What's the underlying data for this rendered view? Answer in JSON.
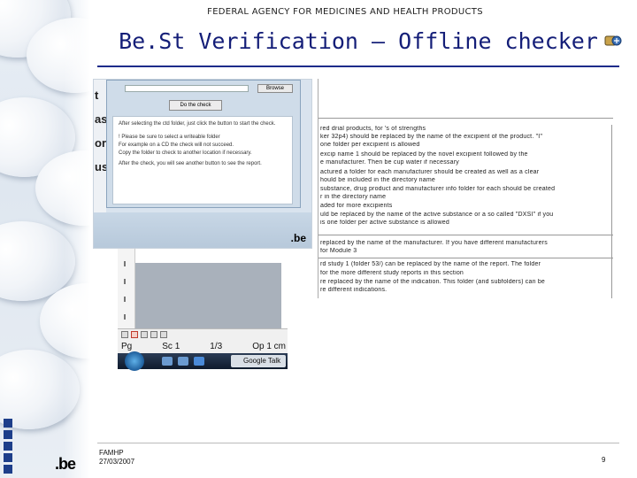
{
  "header": {
    "agency": "FEDERAL AGENCY FOR MEDICINES AND HEALTH PRODUCTS",
    "title": "Be.St Verification – Offline checker"
  },
  "screenshot": {
    "gutter_letters": [
      "t",
      "as",
      "ort",
      "us"
    ],
    "dialog": {
      "browse_label": "Browse",
      "do_check_label": "Do the check",
      "instructions": [
        "After selecting the ctd folder, just click the button to start the check.",
        "! Please be sure to select a writeable folder",
        "For example on a CD the check will not succeed.",
        "Copy the folder to check to another location if necessary.",
        "After the check, you will see another button to see the report."
      ]
    },
    "badge": ".be",
    "status": {
      "page": "Pg",
      "section": "Sc 1",
      "page_of": "1/3",
      "position": "Op 1 cm"
    },
    "taskbar": {
      "app_label": "Google Talk"
    }
  },
  "document": {
    "lines": [
      "red drial products, for 's of strengths",
      "ker 32p4) should be replaced by the name of the excipient of the product. \"I\"",
      "one folder per excipient is allowed",
      "excip name 1 should be replaced by the novel excipient followed by the",
      "e manufacturer. Then be cup water if necessary",
      "actured a folder for each manufacturer should be created as well as a clear",
      "hould be included in the directory name",
      "substance, drug product and manufacturer info folder for each should be created",
      "r in the directory name",
      "aded for more excipients",
      "uld be replaced by the name of the active substance or a so called \"DXSI\" if you",
      "is one folder per active substance is allowed",
      "replaced by the name of the manufacturer. If you have different manufacturers",
      "for Module 3",
      "rd study 1 (folder 53/) can be replaced by the name of the report. The folder",
      "for the more different study reports in this section",
      "re replaced by the name of the indication. This folder (and subfolders) can be",
      "re different indications."
    ]
  },
  "footer": {
    "org": "FAMHP",
    "date": "27/03/2007",
    "logo": ".be",
    "page_number": "9"
  }
}
